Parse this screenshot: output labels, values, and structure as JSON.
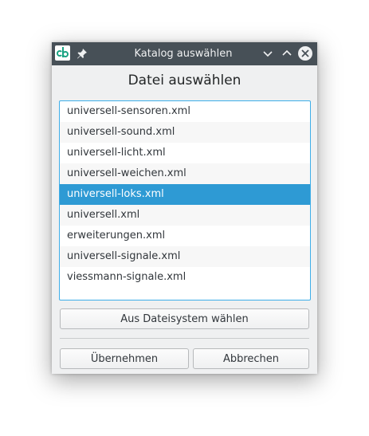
{
  "window": {
    "title": "Katalog auswählen"
  },
  "dialog": {
    "heading": "Datei auswählen"
  },
  "files": {
    "items": [
      {
        "label": "universell-sensoren.xml"
      },
      {
        "label": "universell-sound.xml"
      },
      {
        "label": "universell-licht.xml"
      },
      {
        "label": "universell-weichen.xml"
      },
      {
        "label": "universell-loks.xml",
        "selected": true
      },
      {
        "label": "universell.xml"
      },
      {
        "label": "erweiterungen.xml"
      },
      {
        "label": "universell-signale.xml"
      },
      {
        "label": "viessmann-signale.xml"
      }
    ]
  },
  "buttons": {
    "filesystem": "Aus Dateisystem wählen",
    "accept": "Übernehmen",
    "cancel": "Abbrechen"
  },
  "icons": {
    "app": "app-logo-icon",
    "pin": "pin-icon",
    "minimize": "chevron-down-icon",
    "maximize": "chevron-up-icon",
    "close": "close-icon"
  },
  "colors": {
    "titlebar": "#475057",
    "selection": "#2e9ad4",
    "focus_border": "#3daee9",
    "app_accent": "#1aa383"
  }
}
